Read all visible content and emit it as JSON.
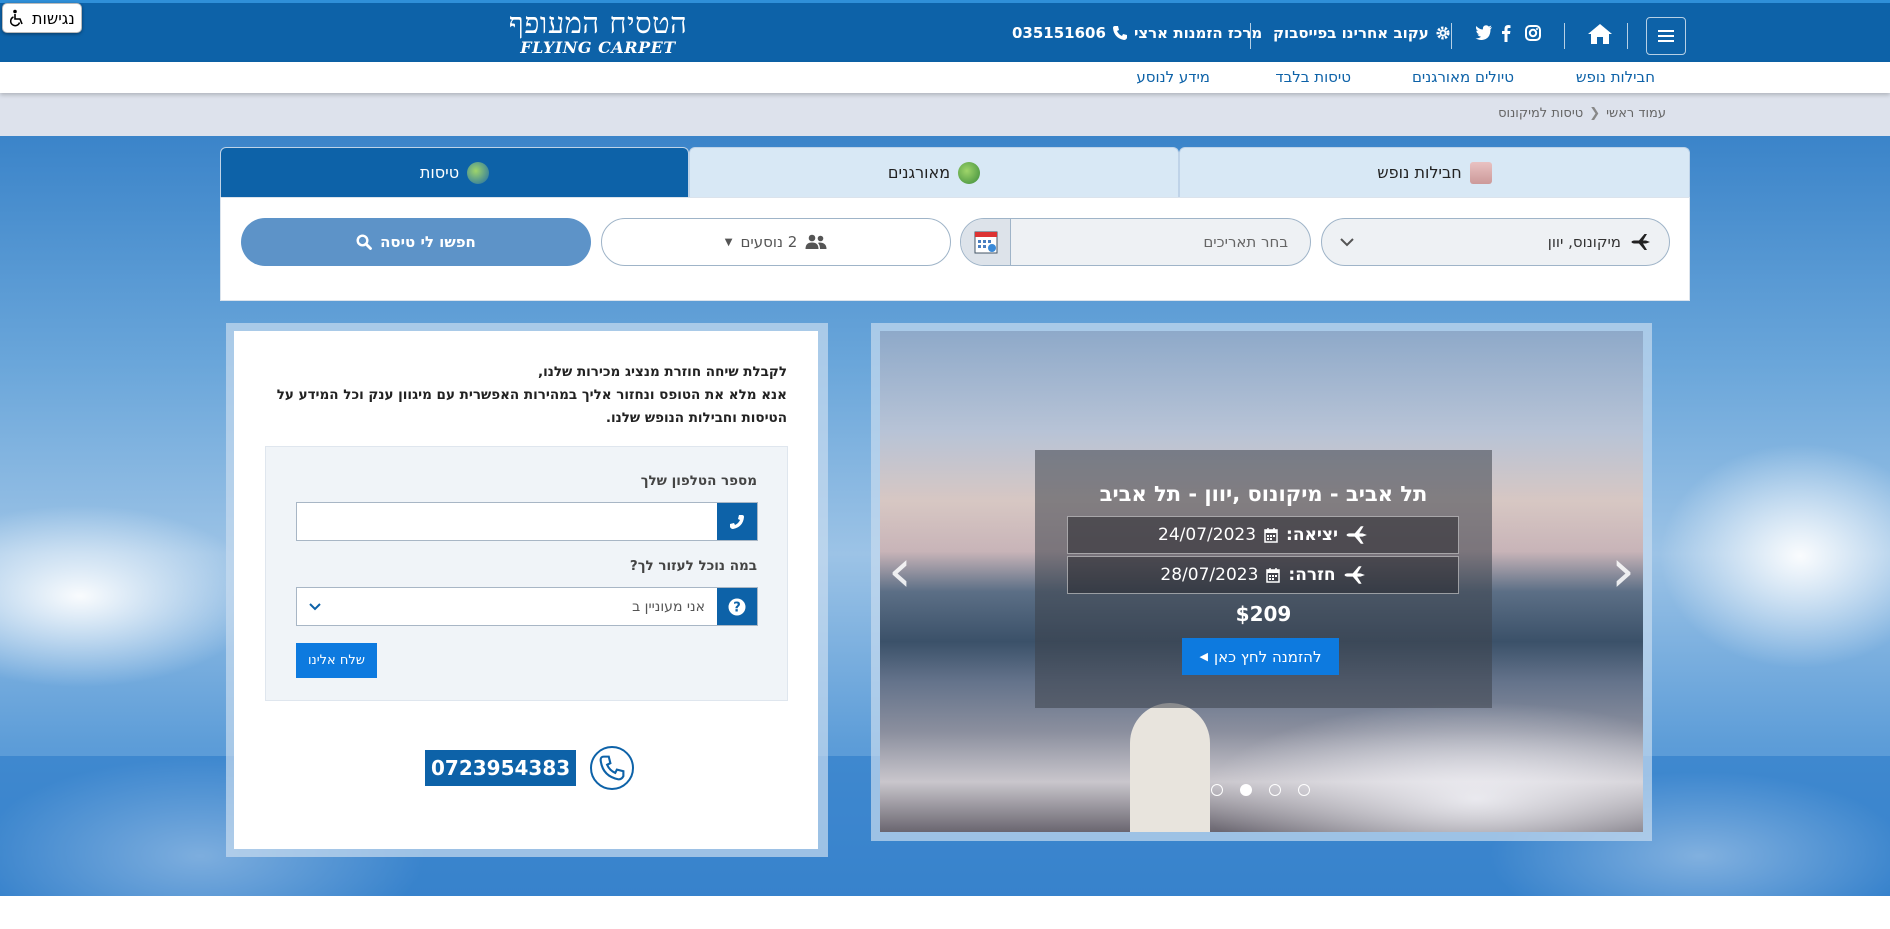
{
  "header": {
    "logo_hebrew": "הטסיח המעופף",
    "logo_english": "FLYING CARPET",
    "accessibility_label": "נגישות",
    "phone_label": "מרכז הזמנות ארצי",
    "phone_number": "035151606",
    "facebook_label": "עקוב אחרינו בפייסבוק"
  },
  "subnav": {
    "items": [
      "חבילות נופש",
      "טיולים מאורגנים",
      "טיסות בלבד",
      "מידע לנוסע"
    ]
  },
  "breadcrumb": {
    "home": "עמוד ראשי",
    "current": "טיסות למיקונוס"
  },
  "search": {
    "tabs": [
      {
        "label": "חבילות נופש"
      },
      {
        "label": "מאורגנים"
      },
      {
        "label": "טיסות"
      }
    ],
    "destination_value": "מיקונוס, יוון",
    "dates_placeholder": "בחר תאריכים",
    "passengers_value": "2 נוסעים",
    "submit_label": "חפשו לי טיסה"
  },
  "lead_form": {
    "intro_line1": "לקבלת שיחה חוזרת מנציג מכירות שלנו,",
    "intro_line2": "אנא מלא את הטופס ונחזור אליך במהירות האפשרית עם מיגוון ענק וכל המידע על",
    "intro_line3": "הטיסות וחבילות הנופש שלנו.",
    "phone_label": "מספר הטלפון שלך",
    "phone_value": "",
    "help_label": "במה נוכל לעזור לך?",
    "help_select_value": "אני מעוניין ב",
    "submit_label": "שלח אלינו",
    "hotline_number": "0723954383"
  },
  "carousel": {
    "route_title": "תל אביב - מיקונוס ,יוון - תל אביב",
    "departure_label": "יציאה:",
    "departure_date": "24/07/2023",
    "return_label": "חזרה:",
    "return_date": "28/07/2023",
    "price": "$209",
    "cta_label": "להזמנה לחץ כאן",
    "slide_count": 4,
    "active_slide": 2
  },
  "colors": {
    "brand_blue": "#0d62a8",
    "cta_blue": "#0d7adf",
    "search_button": "#5d93c8"
  }
}
